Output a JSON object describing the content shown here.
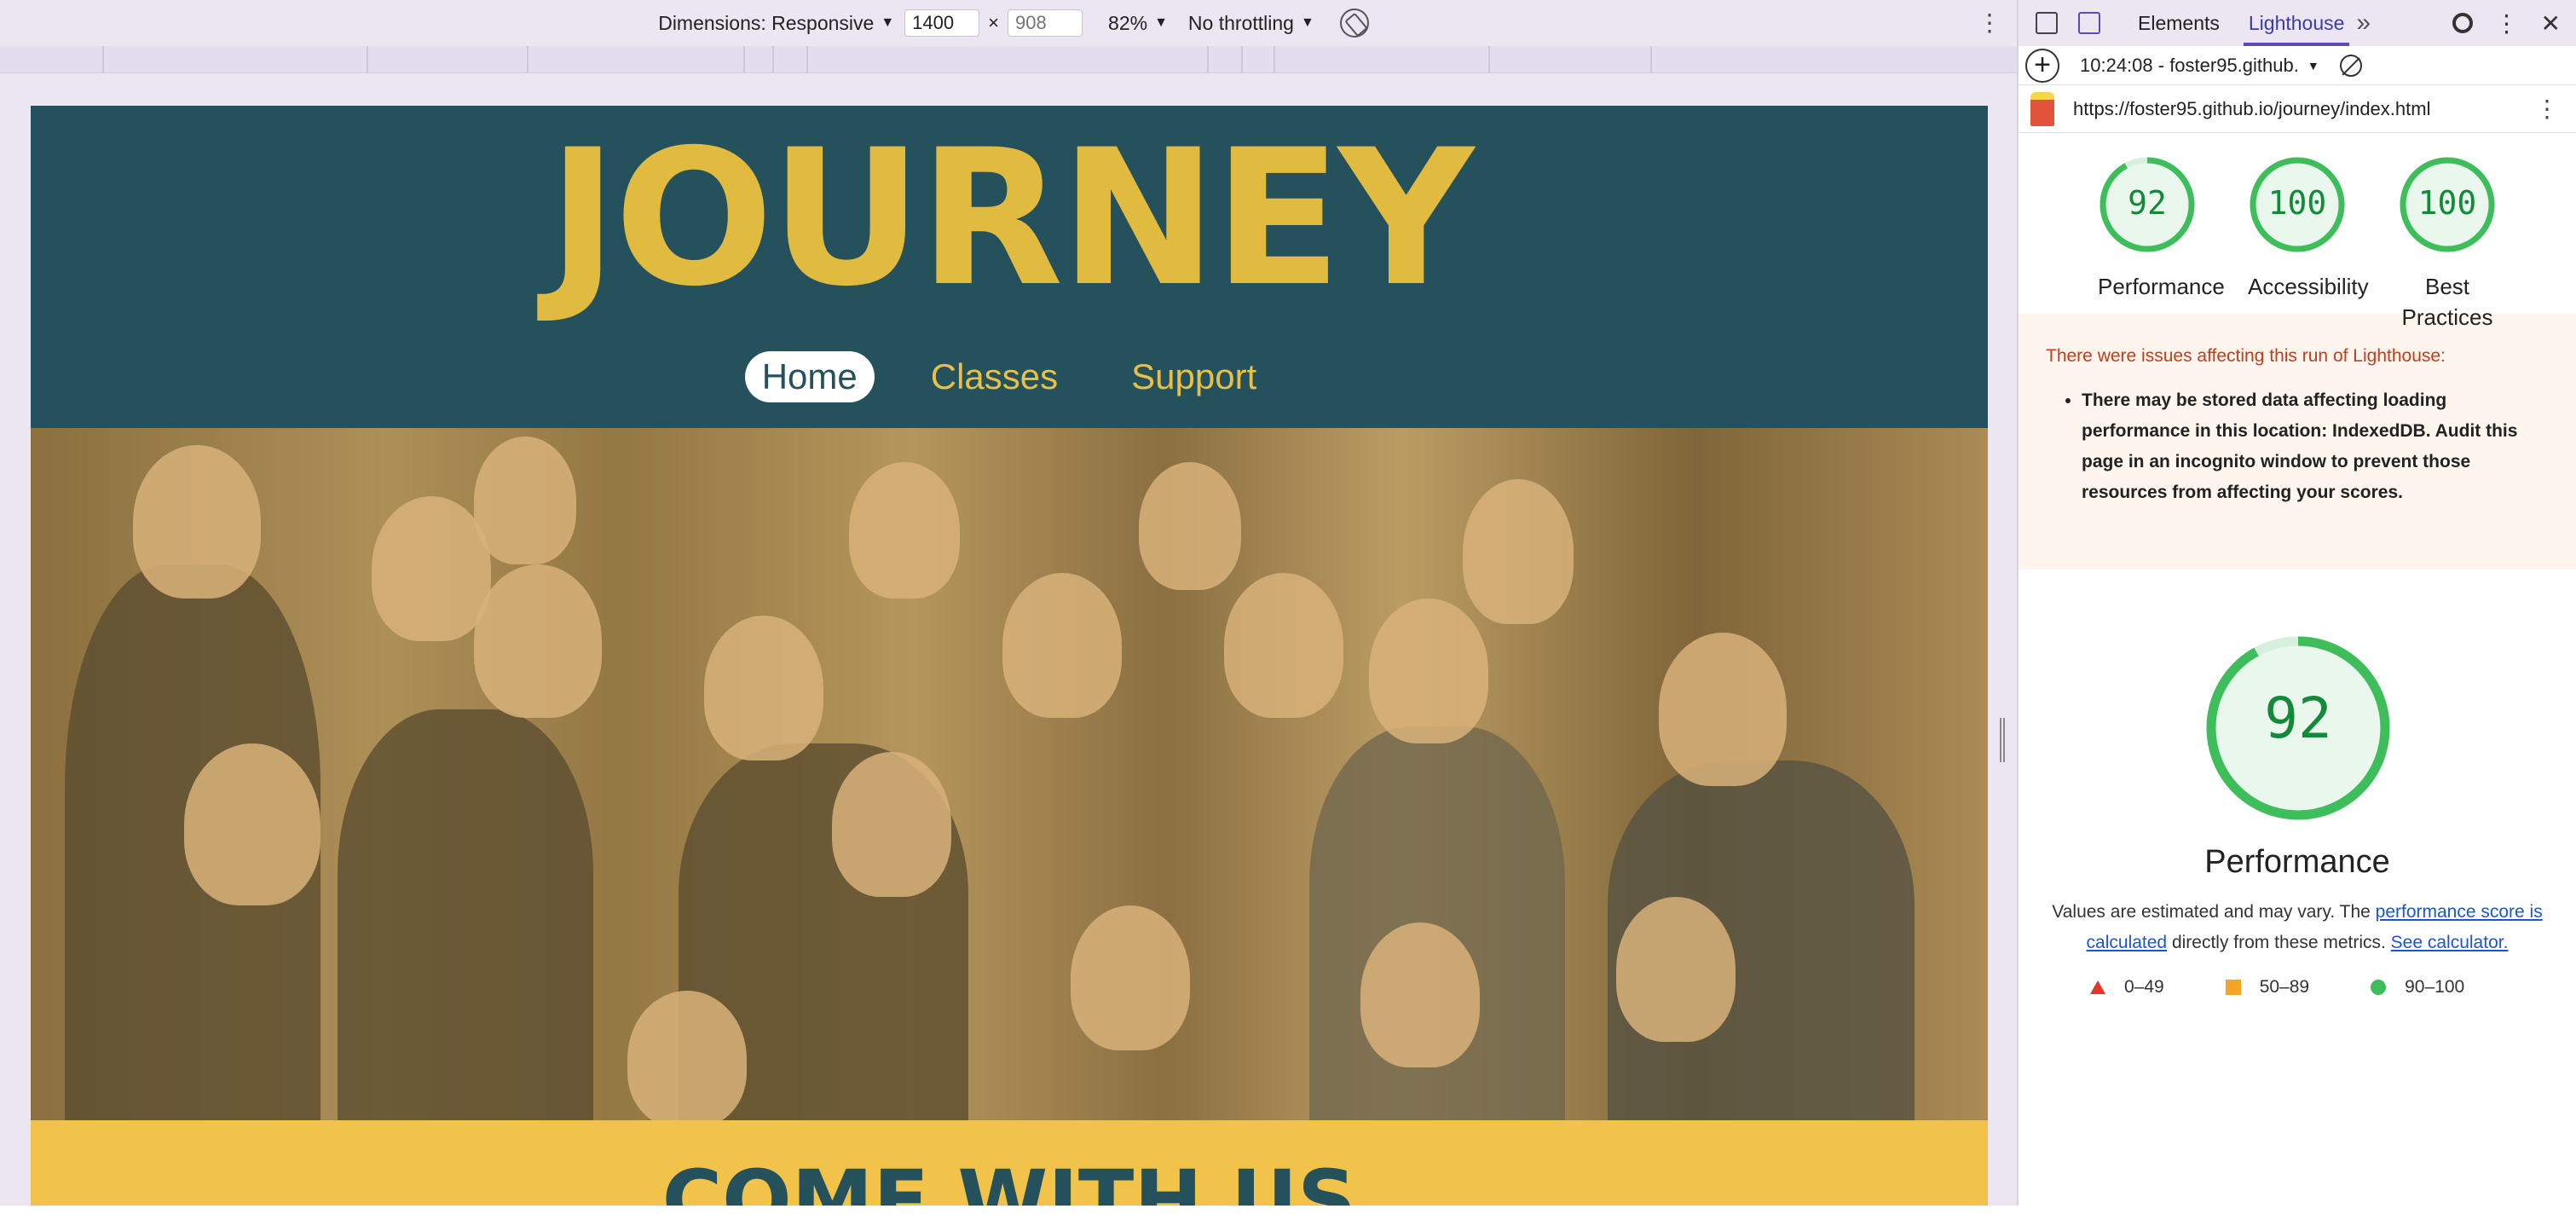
{
  "device_toolbar": {
    "dimensions_label": "Dimensions: Responsive",
    "width_value": "1400",
    "height_placeholder": "908",
    "times": "×",
    "zoom": "82%",
    "throttling": "No throttling"
  },
  "site": {
    "logo": "JOURNEY",
    "nav": [
      "Home",
      "Classes",
      "Support"
    ],
    "cta": "COME WITH US"
  },
  "devtools": {
    "tabs": [
      "Elements",
      "Lighthouse"
    ],
    "active_tab": "Lighthouse",
    "report_time": "10:24:08 - foster95.github.",
    "url": "https://foster95.github.io/journey/index.html",
    "scores": [
      {
        "value": "92",
        "label": "Performance",
        "fraction": 0.92
      },
      {
        "value": "100",
        "label": "Accessibility",
        "fraction": 1.0
      },
      {
        "value": "100",
        "label": "Best Practices",
        "fraction": 1.0
      }
    ],
    "warning_title": "There were issues affecting this run of Lighthouse:",
    "warning_item": "There may be stored data affecting loading performance in this location: IndexedDB. Audit this page in an incognito window to prevent those resources from affecting your scores.",
    "perf_score": "92",
    "perf_fraction": 0.92,
    "perf_title": "Performance",
    "perf_desc_pre": "Values are estimated and may vary. The ",
    "perf_desc_link1": "performance score is calculated",
    "perf_desc_mid": " directly from these metrics. ",
    "perf_desc_link2": "See calculator.",
    "legend": [
      "0–49",
      "50–89",
      "90–100"
    ],
    "colors": {
      "pass": "#3ebd5b",
      "average": "#f2a623",
      "fail": "#e5342a",
      "accent": "#5b4bb7"
    }
  }
}
